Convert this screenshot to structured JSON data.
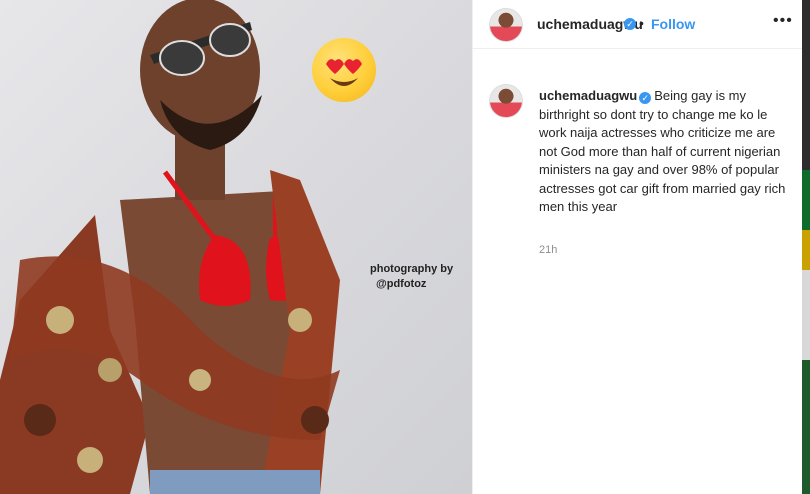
{
  "photo": {
    "credit_line1": "photography by",
    "credit_line2": "@pdfotoz",
    "emoji": "heart-eyes-emoji"
  },
  "header": {
    "username": "uchemaduagwu",
    "separator": "•",
    "follow_label": "Follow",
    "more_icon": "•••"
  },
  "caption": {
    "username": "uchemaduagwu",
    "text": "Being gay is my birthright so dont try to change me ko le work naija actresses who criticize me are not God more than half of current nigerian ministers na gay and over 98% of popular actresses got car gift from married gay rich men this year",
    "time": "21h"
  },
  "colors": {
    "accent": "#3897f0",
    "bra": "#e0121b"
  }
}
